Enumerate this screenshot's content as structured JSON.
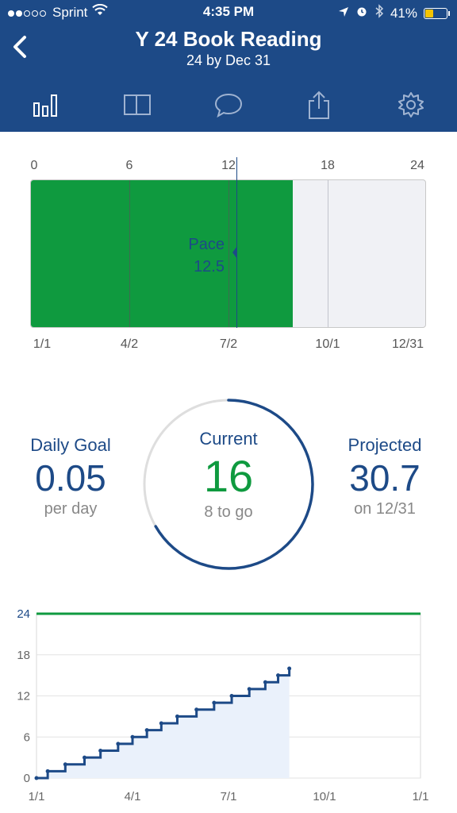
{
  "status_bar": {
    "carrier": "Sprint",
    "time": "4:35 PM",
    "battery_percent": "41%",
    "battery_level": 0.41,
    "signal_bars_filled": 2,
    "signal_bars_total": 5
  },
  "header": {
    "title": "Y 24 Book Reading",
    "subtitle": "24 by Dec 31",
    "background": "#1d4a87"
  },
  "tabs": [
    {
      "name": "stats",
      "icon": "bar-chart-icon",
      "active": true
    },
    {
      "name": "log",
      "icon": "book-icon",
      "active": false
    },
    {
      "name": "comments",
      "icon": "speech-bubble-icon",
      "active": false
    },
    {
      "name": "share",
      "icon": "share-icon",
      "active": false
    },
    {
      "name": "settings",
      "icon": "gear-icon",
      "active": false
    }
  ],
  "progress": {
    "top_ticks": [
      "0",
      "6",
      "12",
      "18",
      "24"
    ],
    "bottom_ticks": [
      "1/1",
      "4/2",
      "7/2",
      "10/1",
      "12/31"
    ],
    "current": 16,
    "goal": 24,
    "pace_label": "Pace",
    "pace_value": "12.5",
    "pace": 12.5,
    "fill_color": "#0f9a3f"
  },
  "stats": {
    "daily_goal_label": "Daily Goal",
    "daily_goal_value": "0.05",
    "daily_goal_sub": "per day",
    "current_label": "Current",
    "current_value": "16",
    "current_sub": "8 to go",
    "current_fraction": 0.6667,
    "projected_label": "Projected",
    "projected_value": "30.7",
    "projected_sub": "on 12/31"
  },
  "chart_data": {
    "type": "line",
    "x_tick_labels": [
      "1/1",
      "4/1",
      "7/1",
      "10/1",
      "1/1"
    ],
    "y_tick_labels": [
      "0",
      "6",
      "12",
      "18",
      "24"
    ],
    "ylim": [
      0,
      24
    ],
    "goal_line": 24,
    "goal_color": "#0f9a3f",
    "series_color": "#1d4a87",
    "series": [
      {
        "x_month_fraction": [
          0,
          0.35,
          0.9,
          1.5,
          2.0,
          2.55,
          3.0,
          3.45,
          3.9,
          4.4,
          5.0,
          5.55,
          6.1,
          6.65,
          7.15,
          7.55,
          7.9
        ],
        "values": [
          0,
          1,
          2,
          3,
          4,
          5,
          6,
          7,
          8,
          9,
          10,
          11,
          12,
          13,
          14,
          15,
          16
        ]
      }
    ],
    "grid": true
  }
}
